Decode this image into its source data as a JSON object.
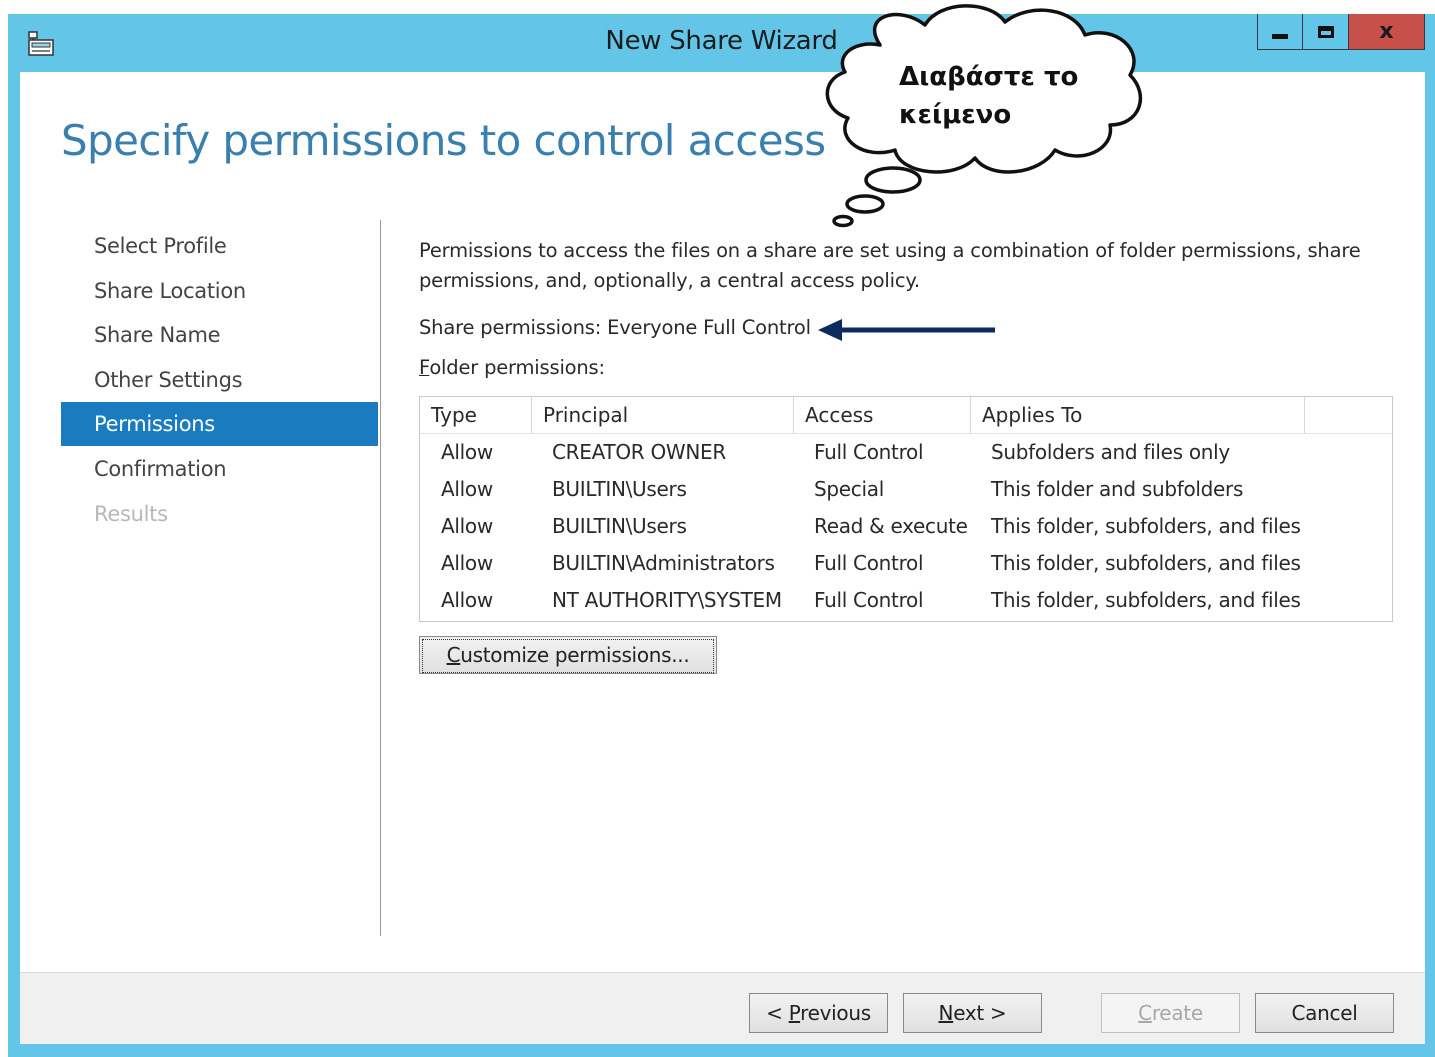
{
  "window": {
    "title": "New Share Wizard",
    "close_glyph": "x",
    "colors": {
      "titlebar": "#63c6e9",
      "close": "#c7504a",
      "accent": "#1a7bc1",
      "heading": "#3a7fad"
    }
  },
  "page": {
    "heading": "Specify permissions to control access"
  },
  "nav": {
    "items": [
      {
        "label": "Select Profile",
        "state": "normal"
      },
      {
        "label": "Share Location",
        "state": "normal"
      },
      {
        "label": "Share Name",
        "state": "normal"
      },
      {
        "label": "Other Settings",
        "state": "normal"
      },
      {
        "label": "Permissions",
        "state": "active"
      },
      {
        "label": "Confirmation",
        "state": "normal"
      },
      {
        "label": "Results",
        "state": "disabled"
      }
    ]
  },
  "content": {
    "intro": "Permissions to access the files on a share are set using a combination of folder permissions, share permissions, and, optionally, a central access policy.",
    "share_permissions": "Share permissions: Everyone Full Control",
    "folder_permissions_label": "Folder permissions:",
    "table": {
      "columns": [
        "Type",
        "Principal",
        "Access",
        "Applies To"
      ],
      "rows": [
        [
          "Allow",
          "CREATOR OWNER",
          "Full Control",
          "Subfolders and files only"
        ],
        [
          "Allow",
          "BUILTIN\\Users",
          "Special",
          "This folder and subfolders"
        ],
        [
          "Allow",
          "BUILTIN\\Users",
          "Read & execute",
          "This folder, subfolders, and files"
        ],
        [
          "Allow",
          "BUILTIN\\Administrators",
          "Full Control",
          "This folder, subfolders, and files"
        ],
        [
          "Allow",
          "NT AUTHORITY\\SYSTEM",
          "Full Control",
          "This folder, subfolders, and files"
        ]
      ]
    },
    "customize_button": "Customize permissions..."
  },
  "footer": {
    "previous": "< Previous",
    "next": "Next >",
    "create": "Create",
    "cancel": "Cancel"
  },
  "annotation": {
    "callout_line1": "Διαβάστε το",
    "callout_line2": "κείμενο"
  }
}
